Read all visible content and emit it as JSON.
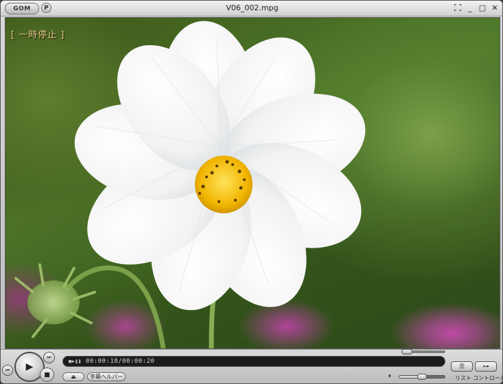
{
  "window": {
    "title": "V06_002.mpg",
    "logo_text": "GOM",
    "pref_label": "P"
  },
  "window_controls": {
    "fullscreen_icon": "fullscreen-icon",
    "minimize_label": "_",
    "maximize_label": "□",
    "close_label": "✕"
  },
  "video": {
    "osd_status": "[ 一時停止 ]"
  },
  "playback": {
    "status_time": "00:00:18/00:00:20",
    "elapsed_fraction": 0.9
  },
  "buttons": {
    "subtitle_helper_label": "字幕ヘルパー",
    "list_label": "リスト",
    "control_label": "コントロール"
  },
  "volume": {
    "level_fraction": 0.5
  },
  "colors": {
    "osd_text": "#f0d98a",
    "logo_accent": "#ffcf3a"
  }
}
